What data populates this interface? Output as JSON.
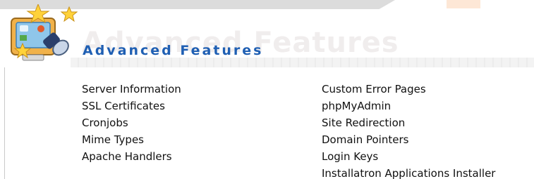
{
  "section": {
    "title": "Advanced Features",
    "watermark": "Advanced Features",
    "icon": "advanced-features-icon"
  },
  "links": {
    "column1": [
      {
        "label": "Server Information"
      },
      {
        "label": "SSL Certificates"
      },
      {
        "label": "Cronjobs"
      },
      {
        "label": "Mime Types"
      },
      {
        "label": "Apache Handlers"
      }
    ],
    "column2": [
      {
        "label": "Custom Error Pages"
      },
      {
        "label": "phpMyAdmin"
      },
      {
        "label": "Site Redirection"
      },
      {
        "label": "Domain Pointers"
      },
      {
        "label": "Login Keys"
      },
      {
        "label": "Installatron Applications Installer"
      }
    ]
  },
  "colors": {
    "title": "#1f5fb3",
    "link": "#111111",
    "top_bar": "#dcdcdc"
  }
}
